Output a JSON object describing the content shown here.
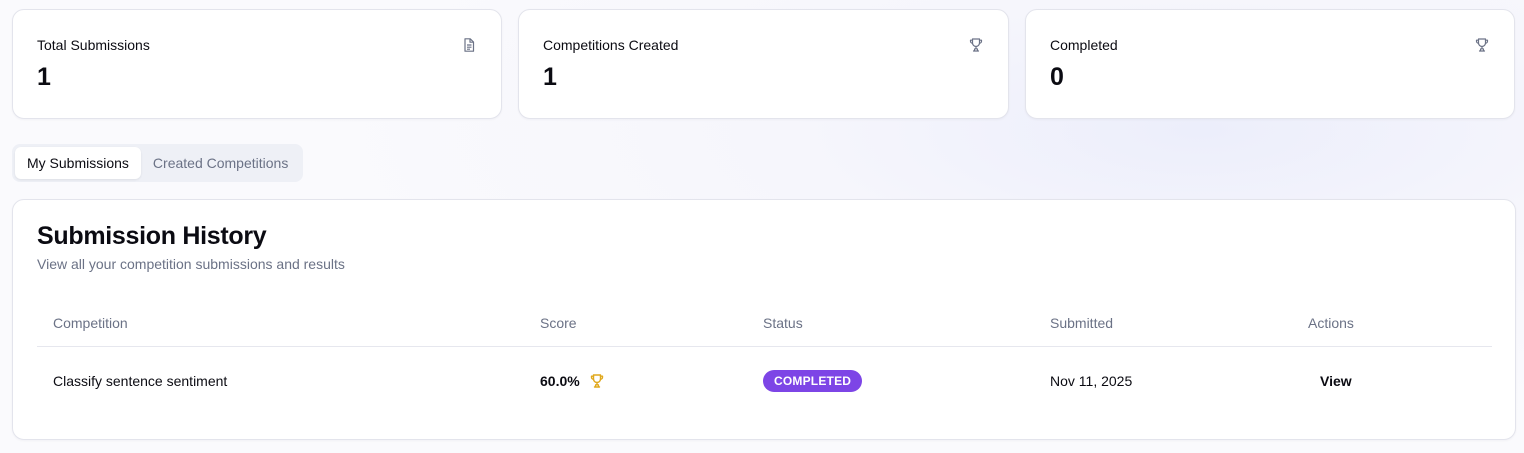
{
  "stats": [
    {
      "label": "Total Submissions",
      "value": "1",
      "icon": "document-icon"
    },
    {
      "label": "Competitions Created",
      "value": "1",
      "icon": "trophy-icon"
    },
    {
      "label": "Completed",
      "value": "0",
      "icon": "trophy-icon"
    }
  ],
  "tabs": [
    {
      "label": "My Submissions",
      "active": true
    },
    {
      "label": "Created Competitions",
      "active": false
    }
  ],
  "panel": {
    "title": "Submission History",
    "subtitle": "View all your competition submissions and results"
  },
  "table": {
    "headers": [
      "Competition",
      "Score",
      "Status",
      "Submitted",
      "Actions"
    ],
    "rows": [
      {
        "competition": "Classify sentence sentiment",
        "score": "60.0%",
        "score_icon": "trophy-icon",
        "status": "COMPLETED",
        "submitted": "Nov 11, 2025",
        "action": "View"
      }
    ]
  },
  "colors": {
    "status_completed": "#7d45e6",
    "trophy_gold": "#e0a81c",
    "muted_text": "#6b7286"
  }
}
